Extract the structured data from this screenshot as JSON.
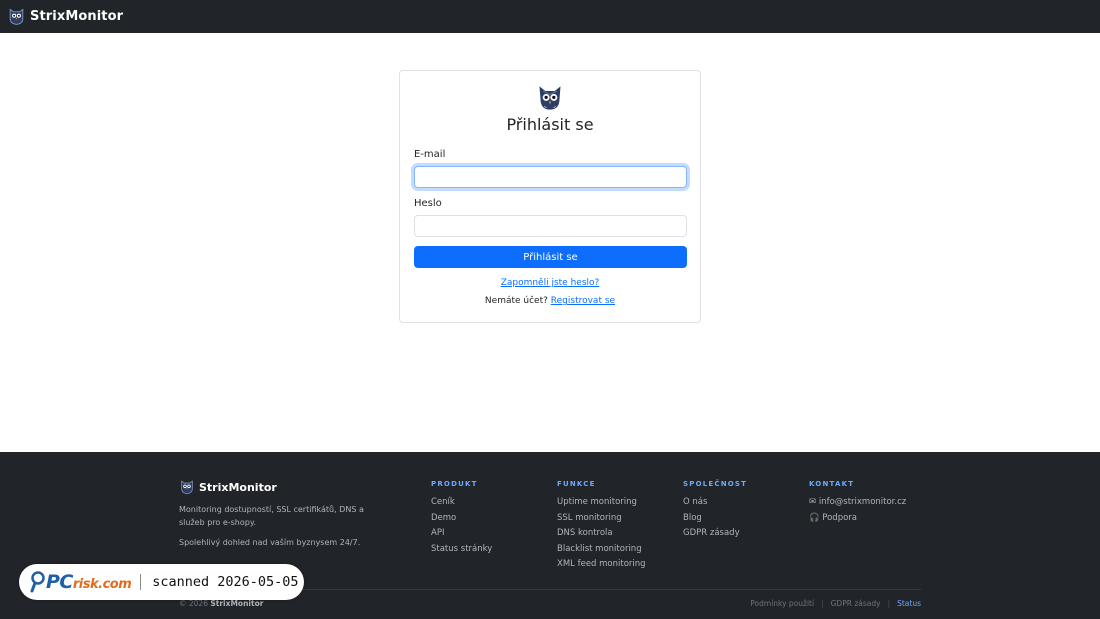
{
  "header": {
    "brand": "StrixMonitor",
    "logo_icon": "owl-icon"
  },
  "login": {
    "title": "Přihlásit se",
    "email_label": "E-mail",
    "email_value": "",
    "password_label": "Heslo",
    "password_value": "",
    "submit_label": "Přihlásit se",
    "forgot_link": "Zapomněli jste heslo?",
    "no_account_text": "Nemáte účet?",
    "register_link": "Registrovat se"
  },
  "footer": {
    "brand": "StrixMonitor",
    "description": "Monitoring dostupností, SSL certifikátů, DNS a služeb pro e-shopy.",
    "tagline": "Spolehlivý dohled nad vaším byznysem 24/7.",
    "columns": [
      {
        "heading": "PRODUKT",
        "links": [
          "Ceník",
          "Demo",
          "API",
          "Status stránky"
        ]
      },
      {
        "heading": "FUNKCE",
        "links": [
          "Uptime monitoring",
          "SSL monitoring",
          "DNS kontrola",
          "Blacklist monitoring",
          "XML feed monitoring"
        ]
      },
      {
        "heading": "SPOLEČNOST",
        "links": [
          "O nás",
          "Blog",
          "GDPR zásady"
        ]
      },
      {
        "heading": "KONTAKT",
        "links": [
          "✉ info@strixmonitor.cz",
          "🎧 Podpora"
        ]
      }
    ],
    "copyright_prefix": "© 2026",
    "copyright_brand": "StrixMonitor",
    "bottom_links": [
      "Podmínky použití",
      "GDPR zásady",
      "Status"
    ]
  },
  "watermark": {
    "logo_text": "PC",
    "logo_suffix": "risk.com",
    "scan_text": "scanned 2026-05-05"
  },
  "colors": {
    "primary": "#0d6efd",
    "dark": "#212529",
    "footer_heading": "#6ea8fe"
  }
}
